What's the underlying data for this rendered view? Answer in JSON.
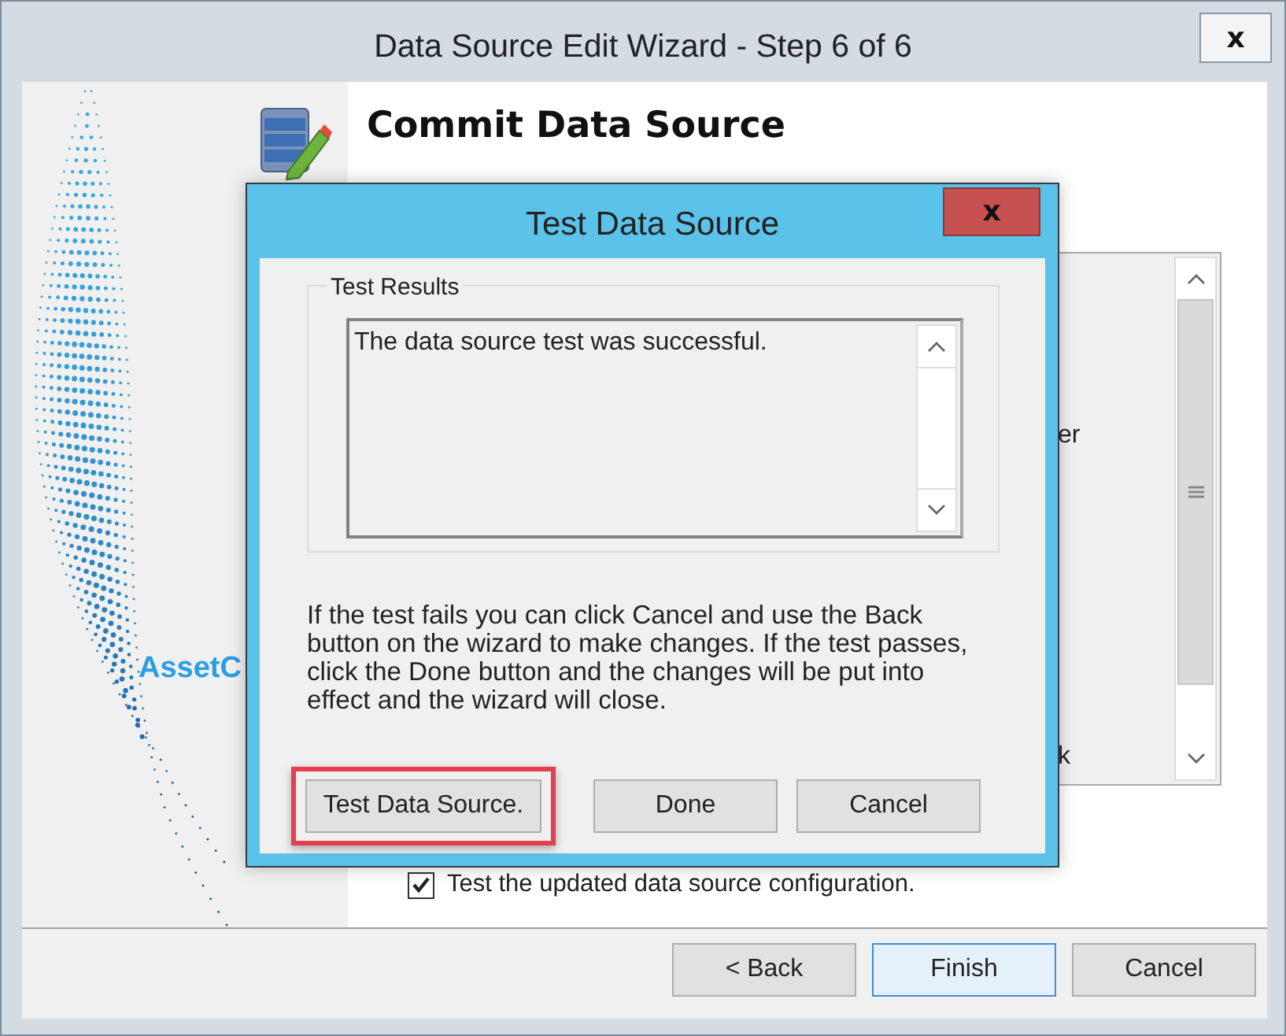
{
  "window": {
    "title": "Data Source Edit Wizard - Step 6 of 6",
    "close": "x"
  },
  "sidebar": {
    "logo_text": "AssetC"
  },
  "header": {
    "title_lines": [
      "Commit Data Source"
    ]
  },
  "list_fragments": [
    "er",
    "k"
  ],
  "test_checkbox": {
    "label": "Test the updated data source configuration.",
    "checked": true
  },
  "buttons": [
    {
      "label": "< Back",
      "default": false
    },
    {
      "label": "Finish",
      "default": true
    },
    {
      "label": "Cancel",
      "default": false
    }
  ],
  "dialog": {
    "title": "Test Data Source",
    "close": "x",
    "group_label": "Test Results",
    "results_text": "The data source test was successful.",
    "help_text": "If the test fails you can click Cancel and use the Back button on the wizard to make changes. If the test passes, click  the Done button and the changes will be put into effect and the wizard will close.",
    "buttons": [
      {
        "label": "Test Data Source.",
        "highlighted": true
      },
      {
        "label": "Done",
        "highlighted": false
      },
      {
        "label": "Cancel",
        "highlighted": false
      }
    ]
  }
}
